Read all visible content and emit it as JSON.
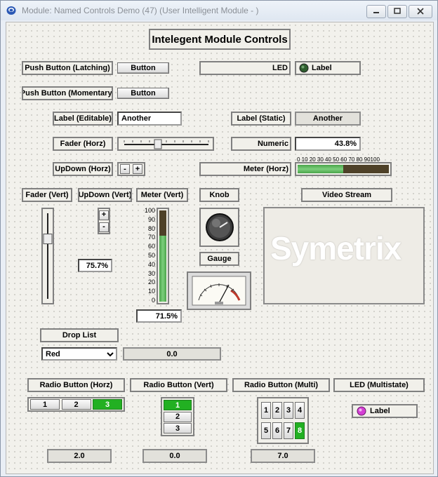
{
  "window": {
    "title": "Module: Named Controls Demo (47) (User Intelligent Module - )",
    "minimize_icon": "minimize-icon",
    "restore_icon": "restore-icon",
    "close_icon": "close-icon"
  },
  "header": {
    "title": "Intelegent Module Controls"
  },
  "controls": {
    "push_latching_label": "Push Button (Latching)",
    "push_latching_button": "Button",
    "push_momentary_label": "Push Button (Momentary)",
    "push_momentary_button": "Button",
    "led_label": "LED",
    "led_text": "Label",
    "label_editable_label": "Label (Editable)",
    "label_editable_value": "Another",
    "label_static_label": "Label (Static)",
    "label_static_value": "Another",
    "fader_horz_label": "Fader (Horz)",
    "fader_horz_level": 0.4,
    "numeric_label": "Numeric",
    "numeric_value": "43.8%",
    "updown_horz_label": "UpDown (Horz)",
    "updown_minus": "-",
    "updown_plus": "+",
    "meter_horz_label": "Meter (Horz)",
    "meter_horz_scale": "0  10 20 30 40 50 60 70 80 90100",
    "meter_horz_level": 0.5,
    "fader_vert_label": "Fader (Vert)",
    "fader_vert_level": 0.7,
    "updown_vert_label": "UpDown (Vert)",
    "updown_vert_plus": "+",
    "updown_vert_minus": "-",
    "updown_vert_value": "75.7%",
    "meter_vert_label": "Meter (Vert)",
    "meter_vert_scale": [
      "100",
      "90",
      "80",
      "70",
      "60",
      "50",
      "40",
      "30",
      "20",
      "10",
      "0"
    ],
    "meter_vert_level": 0.72,
    "meter_vert_value": "71.5%",
    "knob_label": "Knob",
    "gauge_label": "Gauge",
    "video_label": "Video Stream",
    "video_watermark": "Symetrix",
    "droplist_label": "Drop List",
    "droplist_value": "Red",
    "droplist_readout": "0.0",
    "radio_horz_label": "Radio Button (Horz)",
    "radio_horz_options": [
      "1",
      "2",
      "3"
    ],
    "radio_horz_value": "2.0",
    "radio_vert_label": "Radio Button (Vert)",
    "radio_vert_options": [
      "1",
      "2",
      "3"
    ],
    "radio_vert_value": "0.0",
    "radio_multi_label": "Radio Button (Multi)",
    "radio_multi_options": [
      "1",
      "2",
      "3",
      "4",
      "5",
      "6",
      "7",
      "8"
    ],
    "radio_multi_value": "7.0",
    "led_multi_label": "LED (Multistate)",
    "led_multi_text": "Label"
  },
  "colors": {
    "accent_green": "#22b022",
    "led_dark": "#2e5e2e",
    "led_magenta": "#d43fd4"
  }
}
